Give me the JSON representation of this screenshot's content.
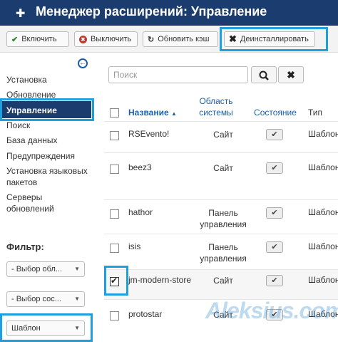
{
  "header": {
    "title": "Менеджер расширений: Управление"
  },
  "toolbar": {
    "enable": "Включить",
    "disable": "Выключить",
    "refresh": "Обновить кэш",
    "uninstall": "Деинсталлировать"
  },
  "sidebar": {
    "items": [
      "Установка",
      "Обновление",
      "Управление",
      "Поиск",
      "База данных",
      "Предупреждения",
      "Установка языковых пакетов",
      "Серверы обновлений"
    ],
    "active": "Управление"
  },
  "filter": {
    "title": "Фильтр:",
    "selects": [
      "- Выбор обл...",
      "- Выбор сос...",
      "Шаблон"
    ]
  },
  "search": {
    "placeholder": "Поиск"
  },
  "table": {
    "headers": {
      "name": "Название",
      "area": "Область системы",
      "state": "Состояние",
      "type": "Тип"
    },
    "rows": [
      {
        "name": "RSEvento!",
        "area": "Сайт",
        "type": "Шаблон",
        "checked": false
      },
      {
        "name": "beez3",
        "area": "Сайт",
        "type": "Шаблон",
        "checked": false
      },
      {
        "name": "hathor",
        "area": "Панель управления",
        "type": "Шаблон",
        "checked": false
      },
      {
        "name": "isis",
        "area": "Панель управления",
        "type": "Шаблон",
        "checked": false
      },
      {
        "name": "jm-modern-store",
        "area": "Сайт",
        "type": "Шаблон",
        "checked": true
      },
      {
        "name": "protostar",
        "area": "Сайт",
        "type": "Шаблон",
        "checked": false
      }
    ]
  },
  "watermark": "Aleksius.com",
  "colors": {
    "header_bg": "#1b3c6e",
    "highlight": "#1ea0e0",
    "link": "#1b5fa8"
  }
}
